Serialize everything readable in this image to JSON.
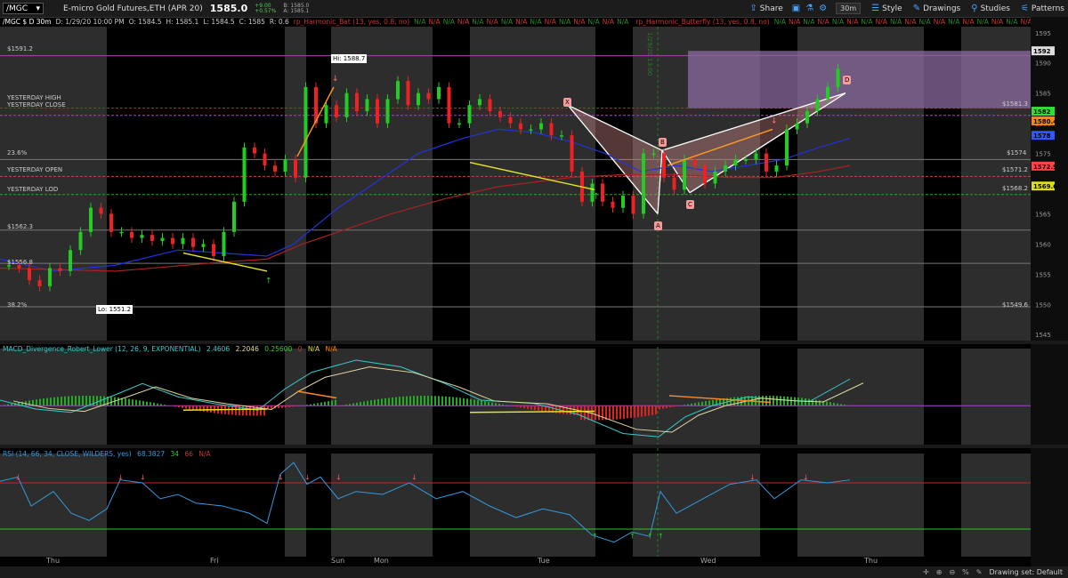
{
  "toolbar": {
    "symbol": "/MGC",
    "name": "E-micro Gold Futures,ETH (APR 20)",
    "price": "1585.0",
    "change_line1": "+9.00",
    "change_line2": "+0.57%",
    "bid_line1": "B: 1585.0",
    "bid_line2": "A: 1585.1",
    "share": "Share",
    "timeframe": "30m",
    "style": "Style",
    "drawings": "Drawings",
    "studies": "Studies",
    "patterns": "Patterns"
  },
  "infoline": {
    "symbol_label": "/MGC $ D 30m",
    "date": "D: 1/29/20 10:00 PM",
    "open": "O: 1584.5",
    "high": "H: 1585.1",
    "low": "L: 1584.5",
    "close": "C: 1585",
    "range": "R: 0.6",
    "study1": "rp_Harmonic_Bat (13, yes, 0.8, no)",
    "study2": "rp_Harmonic_Butterfly (13, yes, 0.8, no)",
    "na": "N/A"
  },
  "price_axis": {
    "ticks": [
      "1595",
      "1590",
      "1585",
      "1580",
      "1575",
      "1570",
      "1565",
      "1560",
      "1555",
      "1550",
      "1545"
    ],
    "tags": [
      {
        "text": "1592",
        "color": "#dddddd"
      },
      {
        "text": "1582",
        "color": "#33dd33"
      },
      {
        "text": "1580.4",
        "color": "#ff8800"
      },
      {
        "text": "1578",
        "color": "#3355ff"
      },
      {
        "text": "1572.9",
        "color": "#ff4444"
      },
      {
        "text": "1569.6",
        "color": "#dddd22"
      }
    ]
  },
  "levels": [
    {
      "text": "$1591.2",
      "color": "#aa44aa"
    },
    {
      "text": "YESTERDAY HIGH",
      "color": "#cc2222"
    },
    {
      "text": "YESTERDAY CLOSE",
      "color": "#aa44cc"
    },
    {
      "text": "23.6%",
      "color": "#999999"
    },
    {
      "text": "YESTERDAY OPEN",
      "color": "#cc4444"
    },
    {
      "text": "YESTERDAY LOD",
      "color": "#22aa22"
    },
    {
      "text": "$1562.3",
      "color": "#999999"
    },
    {
      "text": "$1556.8",
      "color": "#999999"
    },
    {
      "text": "38.2%",
      "color": "#999999"
    },
    {
      "text": "$1574",
      "color": "#999999"
    },
    {
      "text": "$1571.2",
      "color": "#cc4444"
    },
    {
      "text": "$1568.2",
      "color": "#22aa22"
    },
    {
      "text": "$1581.3",
      "color": "#aa44cc"
    },
    {
      "text": "$1549.6",
      "color": "#999999"
    }
  ],
  "annotations": {
    "hi": "Hi: 1588.7",
    "lo": "Lo: 1551.2",
    "x": "X",
    "a": "A",
    "b": "B",
    "c": "C",
    "d": "D",
    "vertical": "1/29/20 13:00"
  },
  "macd": {
    "title": "MACD_Divergence_Robert_Lower (12, 26, 9, EXPONENTIAL)",
    "v1": "2.4606",
    "v2": "2.2046",
    "v3": "0.25600",
    "v4": "0",
    "na": "N/A",
    "ticks": [
      "4",
      "3",
      "2",
      "1",
      "0",
      "-1",
      "-2",
      "-3"
    ],
    "tags": [
      {
        "text": "2.4606",
        "color": "#33cccc"
      },
      {
        "text": "0.25601",
        "color": "#33cc33"
      },
      {
        "text": "-0.7154",
        "color": "#dddd22"
      }
    ]
  },
  "rsi": {
    "title": "RSI (14, 66, 34, CLOSE, WILDERS, yes)",
    "v1": "68.3827",
    "v2": "34",
    "v3": "66",
    "na": "N/A",
    "ticks": [
      "80",
      "60",
      "40",
      "20"
    ],
    "tags": [
      {
        "text": "68.3828",
        "color": "#33aaee"
      },
      {
        "text": "34",
        "color": "#22cc22"
      }
    ]
  },
  "dates": [
    "Thu",
    "Fri",
    "Sun",
    "Mon",
    "Tue",
    "Wed",
    "Thu"
  ],
  "bottom": {
    "drawing_set": "Drawing set: Default"
  },
  "colors": {
    "up": "#22cc22",
    "down": "#ee2222",
    "ma_blue": "#2233dd",
    "ma_red": "#aa2222",
    "rsi": "#3399dd"
  },
  "chart_data": {
    "type": "candlestick",
    "ylim": [
      1544,
      1596
    ],
    "series": [
      {
        "name": "close",
        "values": [
          1556.5,
          1556,
          1554,
          1553,
          1556,
          1555.5,
          1559,
          1562,
          1566,
          1565,
          1562,
          1562,
          1561,
          1561.5,
          1560.5,
          1561,
          1560,
          1561,
          1559.5,
          1560,
          1558,
          1562,
          1567,
          1576,
          1575,
          1573,
          1572,
          1574,
          1571,
          1586,
          1580,
          1583,
          1581,
          1585,
          1582,
          1584,
          1580,
          1584,
          1587,
          1583,
          1585,
          1584,
          1586,
          1580,
          1580,
          1583,
          1584,
          1582,
          1581,
          1580,
          1579,
          1579,
          1580,
          1578,
          1578,
          1572,
          1567,
          1570,
          1567,
          1566,
          1568,
          1565,
          1575,
          1575,
          1571,
          1569,
          1574,
          1573,
          1570,
          1572,
          1573,
          1574,
          1574,
          1575,
          1572,
          1573,
          1579,
          1580,
          1582,
          1584,
          1586,
          1589
        ]
      }
    ]
  }
}
